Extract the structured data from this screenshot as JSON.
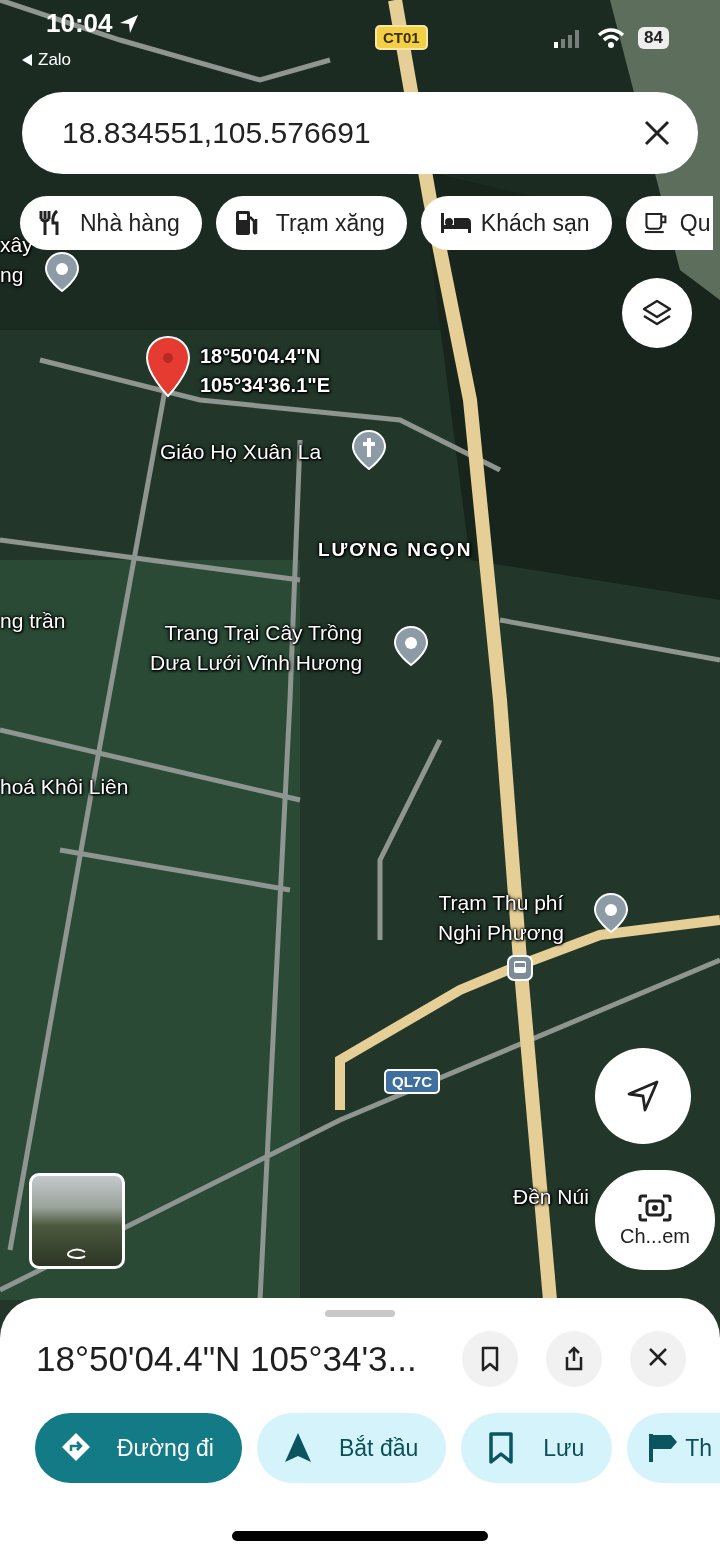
{
  "status_bar": {
    "time": "10:04",
    "back_app": "Zalo",
    "battery": "84"
  },
  "search": {
    "value": "18.834551,105.576691"
  },
  "chips": [
    {
      "label": "Nhà hàng"
    },
    {
      "label": "Trạm xăng"
    },
    {
      "label": "Khách sạn"
    },
    {
      "label": "Qu"
    }
  ],
  "map": {
    "labels": [
      {
        "kind": "place",
        "lines": [
          "xây",
          "ng"
        ]
      },
      {
        "kind": "place",
        "lines": [
          "Giáo Họ Xuân La"
        ]
      },
      {
        "kind": "area",
        "lines": [
          "LƯƠNG NGỌN"
        ]
      },
      {
        "kind": "place",
        "lines": [
          "ng trần"
        ]
      },
      {
        "kind": "place",
        "lines": [
          "Trang Trại Cây Trồng",
          "Dưa Lưới Vĩnh Hương"
        ]
      },
      {
        "kind": "place",
        "lines": [
          "hoá Khôi Liên"
        ]
      },
      {
        "kind": "place",
        "lines": [
          "Trạm Thu phí",
          "Nghi Phương"
        ]
      },
      {
        "kind": "place",
        "lines": [
          "Đền Núi"
        ]
      }
    ],
    "dropped_pin": {
      "lines": [
        "18°50'04.4\"N",
        "105°34'36.1\"E"
      ]
    },
    "road_shields": [
      {
        "kind": "expressway",
        "text": "CT01"
      },
      {
        "kind": "national",
        "text": "QL7C"
      }
    ],
    "camera_button": {
      "label": "Ch...em"
    }
  },
  "sheet": {
    "title": "18°50'04.4\"N 105°34'3...",
    "actions": [
      {
        "kind": "primary",
        "label": "Đường đi"
      },
      {
        "kind": "tonal",
        "label": "Bắt đầu"
      },
      {
        "kind": "tonal",
        "label": "Lưu"
      },
      {
        "kind": "tonal",
        "label": "Th"
      }
    ]
  }
}
